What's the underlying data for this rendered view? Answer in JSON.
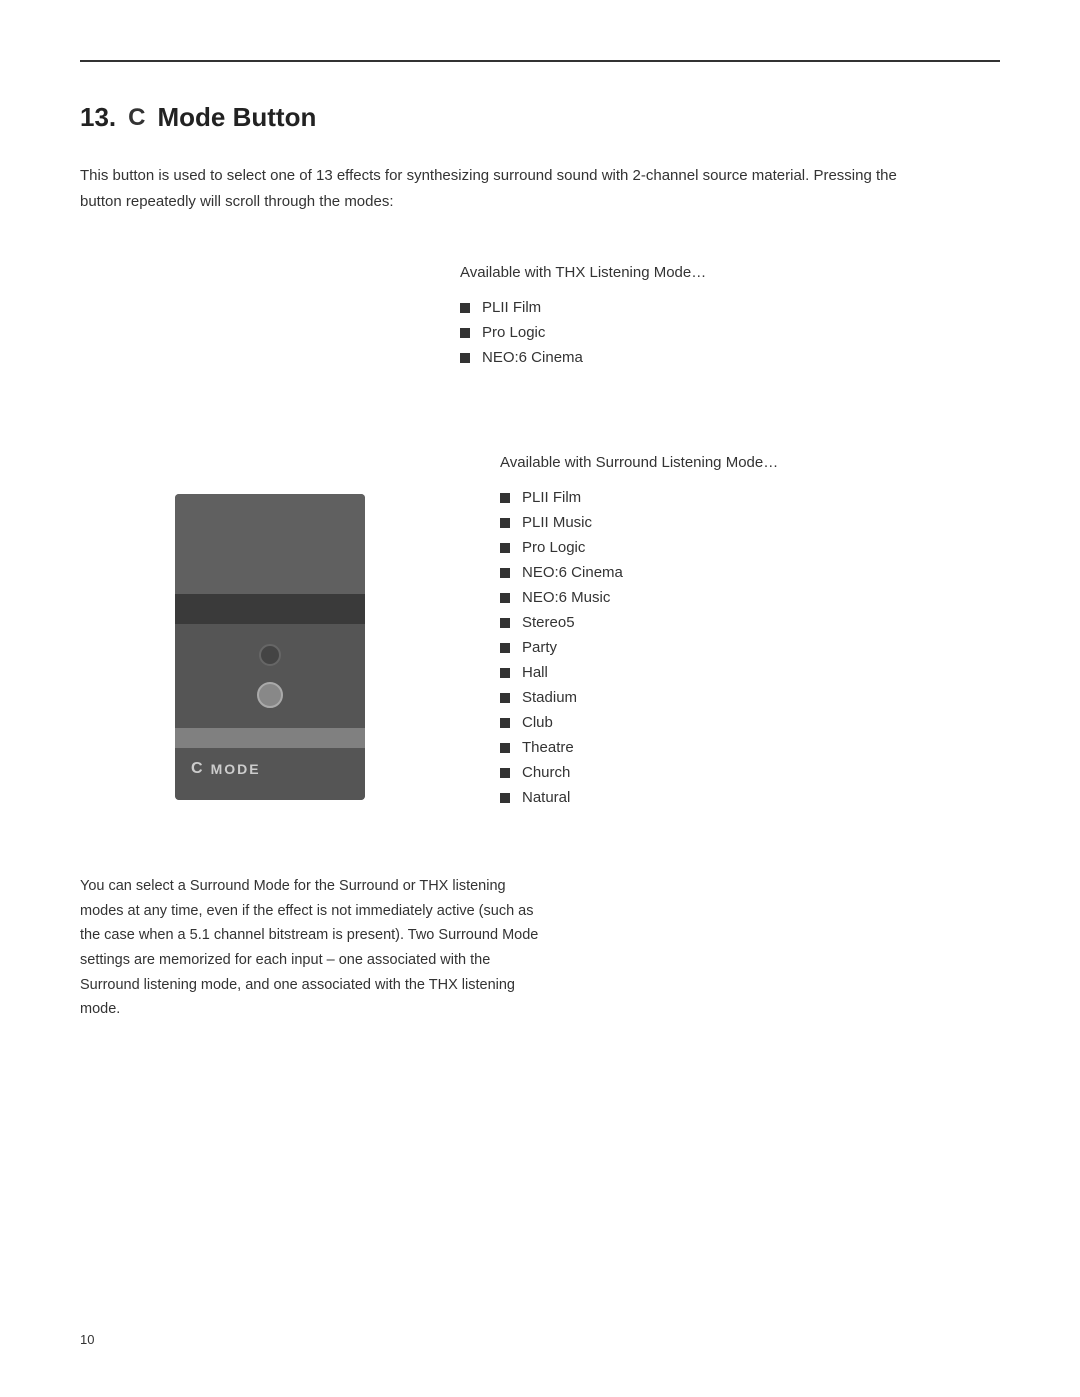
{
  "section": {
    "number": "13.",
    "icon": "C",
    "title": "Mode Button"
  },
  "intro": {
    "text": "This button is used to select one of 13 effects for synthesizing surround sound with 2-channel source material. Pressing the button repeatedly will scroll through the modes:"
  },
  "thx_section": {
    "title": "Available with THX Listening Mode…",
    "items": [
      "PLII Film",
      "Pro Logic",
      "NEO:6 Cinema"
    ]
  },
  "surround_section": {
    "title": "Available with Surround Listening Mode…",
    "items": [
      "PLII Film",
      "PLII Music",
      "Pro Logic",
      "NEO:6 Cinema",
      "NEO:6 Music",
      "Stereo5",
      "Party",
      "Hall",
      "Stadium",
      "Club",
      "Theatre",
      "Church",
      "Natural"
    ]
  },
  "device": {
    "label_icon": "C",
    "label_text": "MODE"
  },
  "footer": {
    "text": "You can select a Surround Mode for the Surround or THX listening modes at any time, even if the effect is not immediately active (such as the case when a 5.1 channel bitstream is present).  Two Surround Mode settings are memorized for each input – one associated with the Surround listening mode, and one associated with the THX listening mode."
  },
  "page_number": "10"
}
